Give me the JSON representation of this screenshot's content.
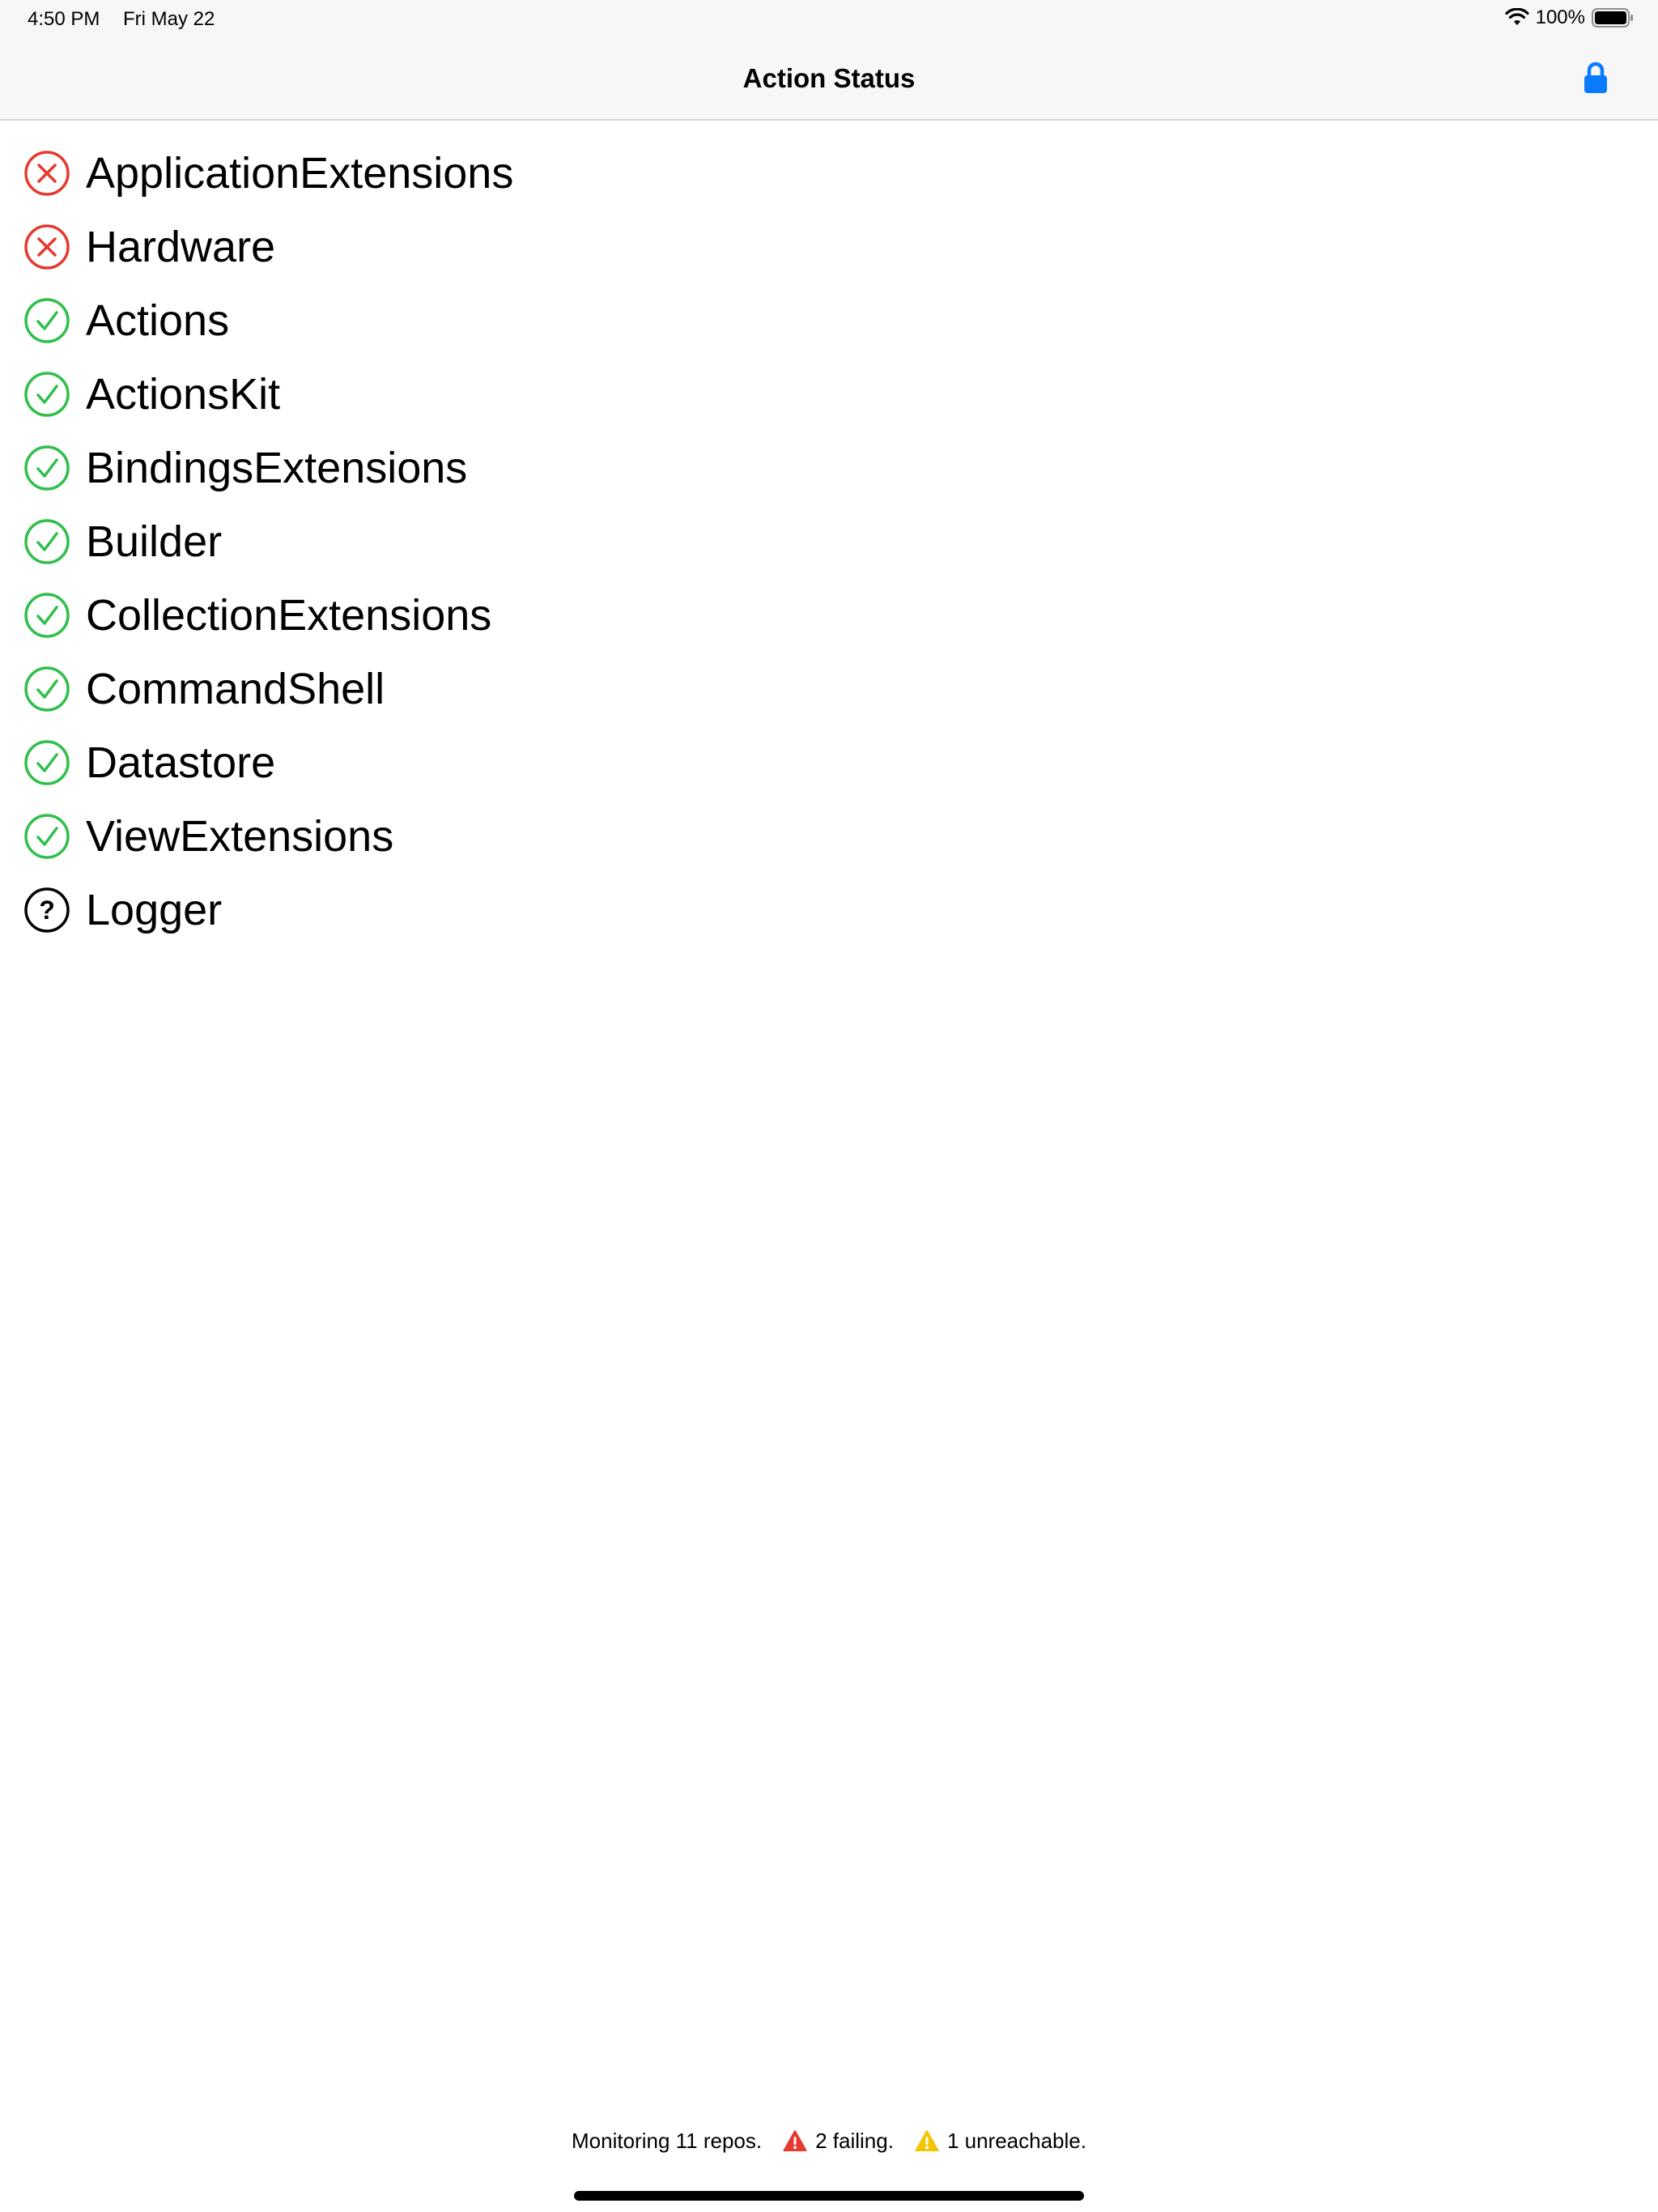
{
  "status_bar": {
    "time": "4:50 PM",
    "date": "Fri May 22",
    "battery": "100%"
  },
  "nav": {
    "title": "Action Status",
    "lock_icon": "lock-icon"
  },
  "colors": {
    "failing": "#e53a2f",
    "passing": "#2fbf4a",
    "unknown": "#000000",
    "accent": "#0a7aff",
    "warning": "#f5c400"
  },
  "repos": [
    {
      "name": "ApplicationExtensions",
      "status": "failing",
      "icon": "x-circle-icon"
    },
    {
      "name": "Hardware",
      "status": "failing",
      "icon": "x-circle-icon"
    },
    {
      "name": "Actions",
      "status": "passing",
      "icon": "check-circle-icon"
    },
    {
      "name": "ActionsKit",
      "status": "passing",
      "icon": "check-circle-icon"
    },
    {
      "name": "BindingsExtensions",
      "status": "passing",
      "icon": "check-circle-icon"
    },
    {
      "name": "Builder",
      "status": "passing",
      "icon": "check-circle-icon"
    },
    {
      "name": "CollectionExtensions",
      "status": "passing",
      "icon": "check-circle-icon"
    },
    {
      "name": "CommandShell",
      "status": "passing",
      "icon": "check-circle-icon"
    },
    {
      "name": "Datastore",
      "status": "passing",
      "icon": "check-circle-icon"
    },
    {
      "name": "ViewExtensions",
      "status": "passing",
      "icon": "check-circle-icon"
    },
    {
      "name": "Logger",
      "status": "unknown",
      "icon": "question-circle-icon"
    }
  ],
  "footer": {
    "monitoring": "Monitoring 11 repos.",
    "failing": "2 failing.",
    "unreachable": "1 unreachable."
  }
}
